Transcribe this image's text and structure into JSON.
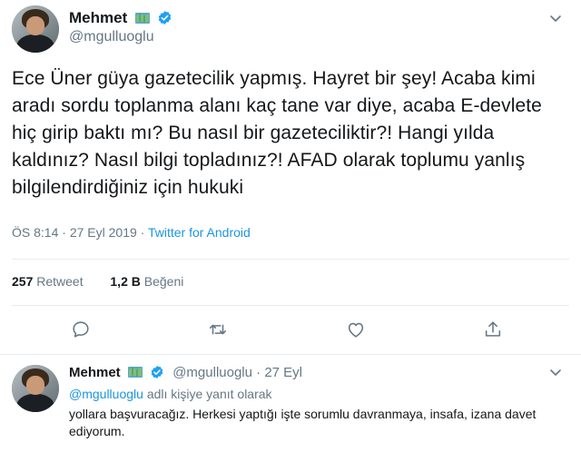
{
  "tweet": {
    "author_name": "Mehmet",
    "author_handle": "@mgulluoglu",
    "body": "Ece Üner güya gazetecilik yapmış. Hayret bir şey! Acaba kimi aradı sordu toplanma alanı kaç tane var diye, acaba E-devlete hiç girip baktı mı? Bu nasıl bir gazeteciliktir?! Hangi yılda kaldınız? Nasıl bilgi topladınız?! AFAD olarak toplumu yanlış bilgilendirdiğiniz için hukuki",
    "time": "ÖS 8:14",
    "separator": "·",
    "date": "27 Eyl 2019",
    "source": "Twitter for Android",
    "retweet_count": "257",
    "retweet_label": "Retweet",
    "like_count": "1,2 B",
    "like_label": "Beğeni"
  },
  "actions": {
    "icons": [
      "reply-icon",
      "retweet-icon",
      "like-icon",
      "share-icon"
    ]
  },
  "reply": {
    "author_name": "Mehmet",
    "author_handle": "@mgulluoglu",
    "separator": "·",
    "date": "27 Eyl",
    "replying_to_mention": "@mgulluoglu",
    "replying_to_suffix": "adlı kişiye yanıt olarak",
    "body": "yollara başvuracağız. Herkesi yaptığı işte sorumlu davranmaya, insafa, izana davet ediyorum."
  },
  "colors": {
    "accent": "#1b95e0",
    "secondary_text": "#657786",
    "primary_text": "#14171a",
    "divider": "#e6ecf0"
  }
}
